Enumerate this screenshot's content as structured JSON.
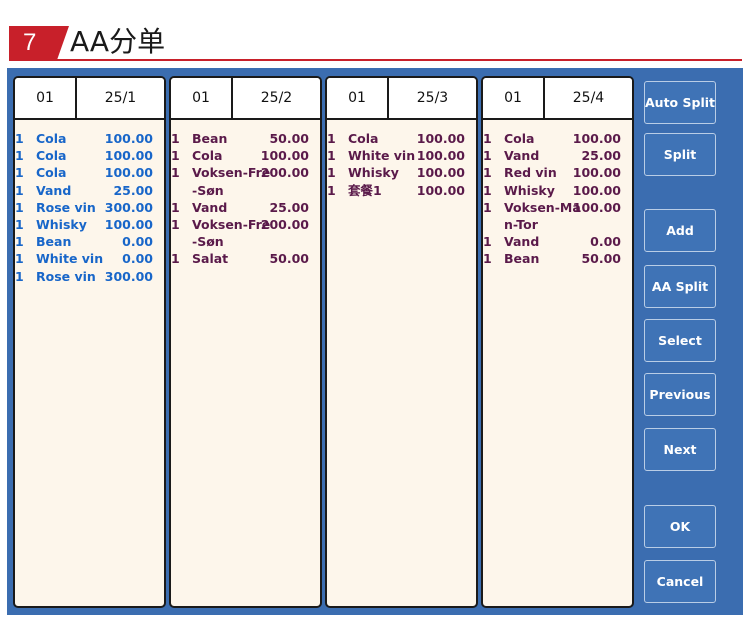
{
  "header": {
    "number": "7",
    "title": "AA分单"
  },
  "bills": [
    {
      "seat": "01",
      "table": "25/1",
      "items": [
        {
          "qty": "1",
          "name": "Cola",
          "price": "100.00"
        },
        {
          "qty": "1",
          "name": "Cola",
          "price": "100.00"
        },
        {
          "qty": "1",
          "name": "Cola",
          "price": "100.00"
        },
        {
          "qty": "1",
          "name": "Vand",
          "price": "25.00"
        },
        {
          "qty": "1",
          "name": "Rose vin",
          "price": "300.00"
        },
        {
          "qty": "1",
          "name": "Whisky",
          "price": "100.00"
        },
        {
          "qty": "1",
          "name": "Bean",
          "price": "0.00"
        },
        {
          "qty": "1",
          "name": "White vin",
          "price": "0.00"
        },
        {
          "qty": "1",
          "name": "Rose vin",
          "price": "300.00"
        }
      ]
    },
    {
      "seat": "01",
      "table": "25/2",
      "items": [
        {
          "qty": "1",
          "name": "Bean",
          "price": "50.00"
        },
        {
          "qty": "1",
          "name": "Cola",
          "price": "100.00"
        },
        {
          "qty": "1",
          "name": "Voksen-Fre",
          "price": "200.00"
        },
        {
          "qty": "",
          "name": "-Søn",
          "price": ""
        },
        {
          "qty": "1",
          "name": "Vand",
          "price": "25.00"
        },
        {
          "qty": "1",
          "name": "Voksen-Fre",
          "price": "200.00"
        },
        {
          "qty": "",
          "name": "-Søn",
          "price": ""
        },
        {
          "qty": "1",
          "name": "Salat",
          "price": "50.00"
        }
      ]
    },
    {
      "seat": "01",
      "table": "25/3",
      "items": [
        {
          "qty": "1",
          "name": "Cola",
          "price": "100.00"
        },
        {
          "qty": "1",
          "name": "White vin",
          "price": "100.00"
        },
        {
          "qty": "1",
          "name": "Whisky",
          "price": "100.00"
        },
        {
          "qty": "1",
          "name": "套餐1",
          "price": "100.00"
        }
      ]
    },
    {
      "seat": "01",
      "table": "25/4",
      "items": [
        {
          "qty": "1",
          "name": "Cola",
          "price": "100.00"
        },
        {
          "qty": "1",
          "name": "Vand",
          "price": "25.00"
        },
        {
          "qty": "1",
          "name": "Red vin",
          "price": "100.00"
        },
        {
          "qty": "1",
          "name": "Whisky",
          "price": "100.00"
        },
        {
          "qty": "1",
          "name": "Voksen-Ma",
          "price": "100.00"
        },
        {
          "qty": "",
          "name": "n-Tor",
          "price": ""
        },
        {
          "qty": "1",
          "name": "Vand",
          "price": "0.00"
        },
        {
          "qty": "1",
          "name": "Bean",
          "price": "50.00"
        }
      ]
    }
  ],
  "buttons": {
    "auto_split": "Auto Split",
    "split": "Split",
    "add": "Add",
    "aa_split": "AA Split",
    "select": "Select",
    "previous": "Previous",
    "next": "Next",
    "ok": "OK",
    "cancel": "Cancel"
  },
  "colors": {
    "accent": "#c8202a",
    "panel": "#3b6db0",
    "bill_bg": "#fdf6eb",
    "text_blue": "#1866c9",
    "text_purple": "#5a1a4a"
  }
}
